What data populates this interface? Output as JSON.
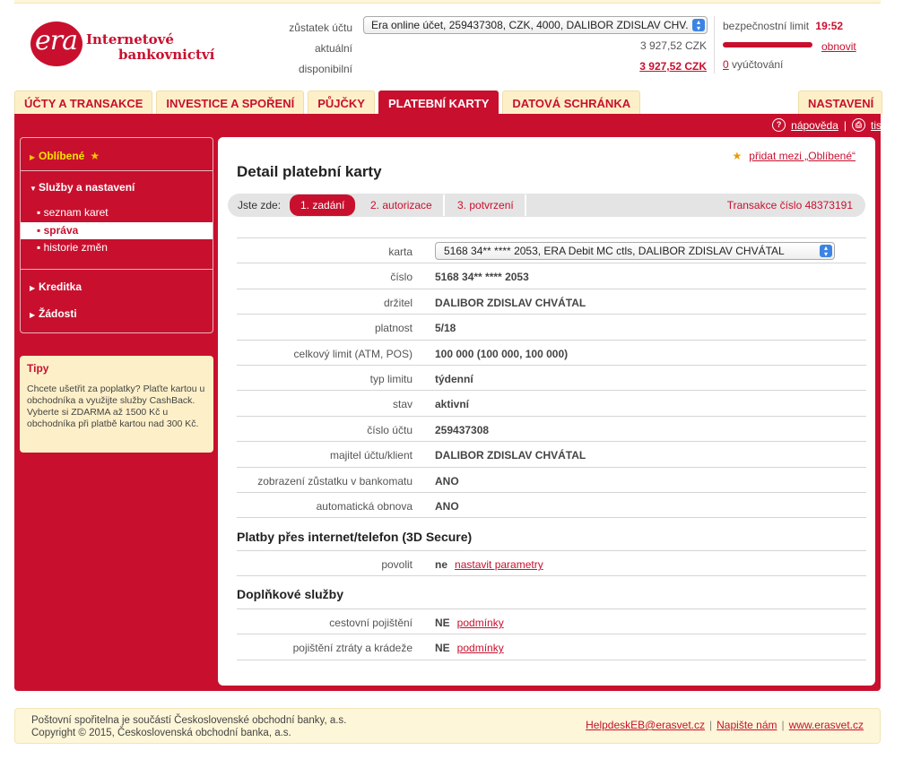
{
  "header": {
    "logo_mark": "era",
    "logo_line1": "Internetové",
    "logo_line2": "bankovnictví",
    "account_label": "zůstatek účtu",
    "account_value": "Era online účet, 259437308, CZK, 4000, DALIBOR ZDISLAV CHV.",
    "actual_label": "aktuální",
    "actual_value": "3 927,52 CZK",
    "available_label": "disponibilní",
    "available_value": "3 927,52 CZK",
    "security_limit_label": "bezpečnostní limit",
    "security_time": "19:52",
    "renew_label": "obnovit",
    "billing_count": "0",
    "billing_label": "vyúčtování"
  },
  "tabs": [
    {
      "label": "ÚČTY A TRANSAKCE"
    },
    {
      "label": "INVESTICE A SPOŘENÍ"
    },
    {
      "label": "PŮJČKY"
    },
    {
      "label": "PLATEBNÍ KARTY"
    },
    {
      "label": "DATOVÁ SCHRÁNKA"
    }
  ],
  "settings_tab": "NASTAVENÍ",
  "toolbar": {
    "help": "nápověda",
    "print": "tisk"
  },
  "sidebar": {
    "favorites": "Oblíbené",
    "services": "Služby a nastavení",
    "items": [
      "seznam karet",
      "správa",
      "historie změn"
    ],
    "credits": "Kreditka",
    "requests": "Žádosti"
  },
  "tips": {
    "title": "Tipy",
    "text": "Chcete ušetřit za poplatky? Plaťte kartou u obchodníka a využijte služby CashBack. Vyberte si ZDARMA až 1500 Kč u obchodníka při platbě kartou nad 300 Kč."
  },
  "main": {
    "add_favorite": "přidat mezi „Oblíbené“",
    "title": "Detail platební karty",
    "breadcrumb_label": "Jste zde:",
    "steps": [
      "1. zadání",
      "2. autorizace",
      "3. potvrzení"
    ],
    "transaction": "Transakce číslo 48373191",
    "card_label": "karta",
    "card_value": "5168 34** **** 2053, ERA Debit MC ctls, DALIBOR ZDISLAV CHVÁTAL",
    "rows": [
      {
        "label": "číslo",
        "value": "5168 34** **** 2053"
      },
      {
        "label": "držitel",
        "value": "DALIBOR ZDISLAV CHVÁTAL"
      },
      {
        "label": "platnost",
        "value": "5/18"
      },
      {
        "label": "celkový limit (ATM, POS)",
        "value": "100 000 (100 000, 100 000)"
      },
      {
        "label": "typ limitu",
        "value": "týdenní"
      },
      {
        "label": "stav",
        "value": "aktivní"
      },
      {
        "label": "číslo účtu",
        "value": "259437308"
      },
      {
        "label": "majitel účtu/klient",
        "value": "DALIBOR ZDISLAV CHVÁTAL"
      },
      {
        "label": "zobrazení zůstatku v bankomatu",
        "value": "ANO"
      },
      {
        "label": "automatická obnova",
        "value": "ANO"
      }
    ],
    "secure_title": "Platby přes internet/telefon (3D Secure)",
    "secure_label": "povolit",
    "secure_value": "ne",
    "secure_link": "nastavit parametry",
    "extra_title": "Doplňkové služby",
    "travel_label": "cestovní pojištění",
    "travel_value": "NE",
    "travel_link": "podmínky",
    "theft_label": "pojištění ztráty a krádeže",
    "theft_value": "NE",
    "theft_link": "podmínky"
  },
  "footer": {
    "line1": "Poštovní spořitelna je součástí Československé obchodní banky, a.s.",
    "line2": "Copyright © 2015, Československá obchodní banka, a.s.",
    "helpdesk": "HelpdeskEB@erasvet.cz",
    "write": "Napište nám",
    "web": "www.erasvet.cz"
  }
}
